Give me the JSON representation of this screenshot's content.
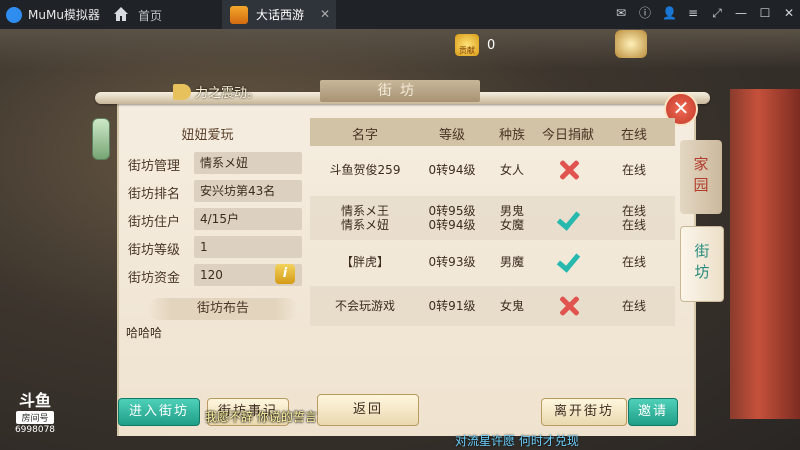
{
  "emulator": {
    "app_name": "MuMu模拟器",
    "home_label": "首页",
    "tab_label": "大话西游",
    "tab_close": "✕",
    "controls": [
      "✉",
      "ⓘ",
      "👤",
      "≡",
      "⤢",
      "—",
      "☐",
      "✕"
    ]
  },
  "game": {
    "contribution_label": "贡献",
    "contribution_value": "0",
    "notice_text": "力之震动。",
    "panel_title": "街坊",
    "close_symbol": "✕"
  },
  "info": {
    "heading": "妞妞爱玩",
    "rows": [
      {
        "label": "街坊管理",
        "value": "情系メ妞"
      },
      {
        "label": "街坊排名",
        "value": "安兴坊第43名"
      },
      {
        "label": "街坊住户",
        "value": "4/15户"
      },
      {
        "label": "街坊等级",
        "value": "1"
      },
      {
        "label": "街坊资金",
        "value": "120"
      }
    ],
    "info_button": "i",
    "bulletin_title": "街坊布告",
    "bulletin_text": "哈哈哈"
  },
  "table": {
    "headers": [
      "名字",
      "等级",
      "种族",
      "今日捐献",
      "在线"
    ],
    "rows": [
      {
        "name": "斗鱼贺俊259",
        "level": "0转94级",
        "race": "女人",
        "donated": false,
        "online": "在线"
      },
      {
        "name": "情系メ王\n情系メ妞",
        "level": "0转95级\n0转94级",
        "race": "男鬼\n女魔",
        "donated": true,
        "online": "在线\n在线"
      },
      {
        "name": "【胖虎】",
        "level": "0转93级",
        "race": "男魔",
        "donated": true,
        "online": "在线"
      },
      {
        "name": "不会玩游戏",
        "level": "0转91级",
        "race": "女鬼",
        "donated": false,
        "online": "在线"
      }
    ]
  },
  "side_tabs": {
    "home": "家园",
    "neighborhood": "街坊"
  },
  "buttons": {
    "enter": "进入街坊",
    "events": "街坊事记",
    "back": "返回",
    "leave": "离开街坊",
    "invite": "邀请"
  },
  "danmu": {
    "line1": "我愿不辞 你说的誓言",
    "line2": "对流星许愿 何时才兑现"
  },
  "watermark": {
    "brand": "斗鱼",
    "room_label": "房间号",
    "room_number": "6998078"
  },
  "colors": {
    "accent_green": "#1f9e88",
    "cross_red": "#e0534e",
    "check_teal": "#27b9ae"
  }
}
